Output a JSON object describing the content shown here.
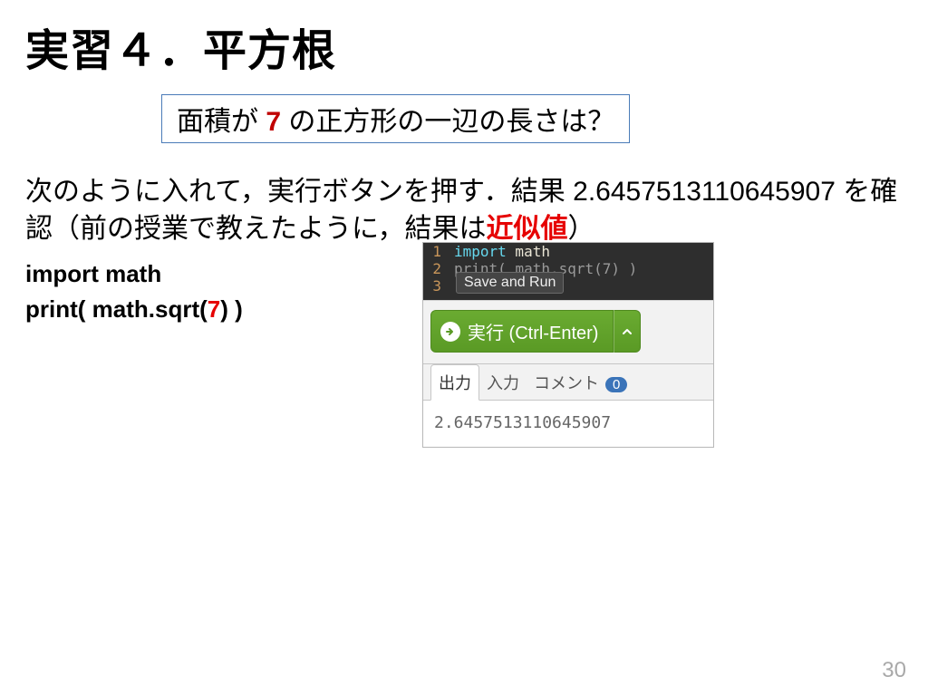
{
  "title": "実習４．平方根",
  "question": {
    "prefix": "面積が ",
    "seven": "7",
    "suffix": " の正方形の一辺の長さは？"
  },
  "instruction": {
    "line1": "次のように入れて，実行ボタンを押す．結果",
    "result_value": "2.6457513110645907",
    "mid": " を確認（前の授業で教えたように，結果は",
    "highlight": "近似値",
    "tail": "）"
  },
  "code": {
    "l1": "import math",
    "l2_pre": "print( math.sqrt(",
    "l2_arg": "7",
    "l2_post": ") )"
  },
  "editor": {
    "rows": [
      "1",
      "2",
      "3"
    ],
    "line1": {
      "kw": "import",
      "rest": " math"
    },
    "line2": {
      "fn": "print",
      "mid": "( math.sqrt(",
      "arg": "7",
      "end": ") )"
    },
    "tooltip": "Save and Run"
  },
  "run": {
    "label": "実行 (Ctrl-Enter)"
  },
  "tabs": {
    "output": "出力",
    "input": "入力",
    "comment": "コメント",
    "count": "0"
  },
  "output_value": "2.6457513110645907",
  "page": "30"
}
